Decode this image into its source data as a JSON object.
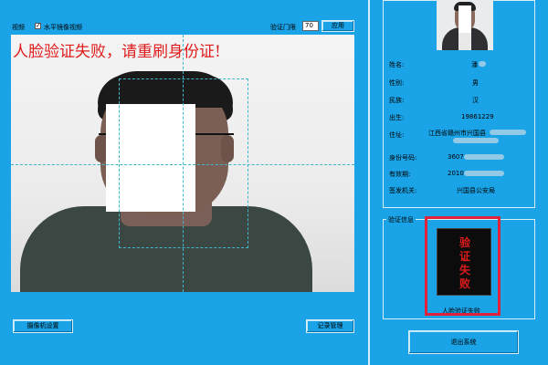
{
  "toolbar": {
    "video_label": "视频",
    "mirror_checkbox_label": "水平镜像视频",
    "mirror_checked": true,
    "threshold_label": "验证门限",
    "threshold_value": "70",
    "apply_button": "应用"
  },
  "video": {
    "alert_text": "人脸验证失败，请重刷身份证!"
  },
  "bottom": {
    "camera_settings_button": "摄像机设置",
    "records_button": "记录管理"
  },
  "id_card": {
    "fields": [
      {
        "label": "姓名:",
        "value": "潘"
      },
      {
        "label": "性别:",
        "value": "男"
      },
      {
        "label": "民族:",
        "value": "汉"
      },
      {
        "label": "出生:",
        "value": "19861229"
      },
      {
        "label": "住址:",
        "value": "江西省赣州市兴国县"
      },
      {
        "label": "身份号码:",
        "value": "3607"
      },
      {
        "label": "有效期:",
        "value": "2010"
      },
      {
        "label": "签发机关:",
        "value": "兴国县公安局"
      }
    ]
  },
  "verify": {
    "group_label": "验证信息",
    "stamp_chars": [
      "验",
      "证",
      "失",
      "败"
    ],
    "result_text": "人脸验证失败",
    "exit_button": "退出系统"
  },
  "colors": {
    "background": "#1aa3e6",
    "alert_red": "#e01b1b",
    "highlight_border": "#e0233a"
  }
}
